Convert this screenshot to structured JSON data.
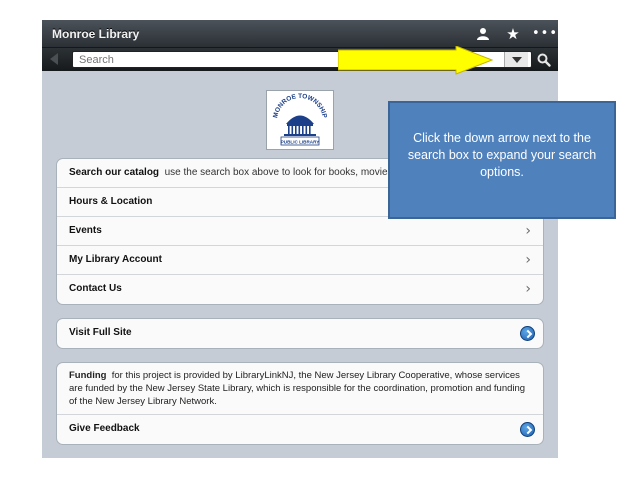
{
  "app": {
    "title": "Monroe Library",
    "toolbar_icons": [
      "person-icon",
      "star-icon",
      "more-icon"
    ]
  },
  "search": {
    "placeholder": "Search",
    "value": ""
  },
  "logo": {
    "text_top": "MONROE TOWNSHIP",
    "text_bottom": "PUBLIC LIBRARY"
  },
  "catalog": {
    "title": "Search our catalog",
    "description": "use the search box above to look for books, movies an"
  },
  "menu": [
    {
      "label": "Hours & Location"
    },
    {
      "label": "Events"
    },
    {
      "label": "My Library Account"
    },
    {
      "label": "Contact Us"
    }
  ],
  "full_site": {
    "label": "Visit Full Site"
  },
  "funding": {
    "title": "Funding",
    "text": "for this project is provided by LibraryLinkNJ, the New Jersey Library Cooperative, whose services are funded by the New Jersey State Library, which is responsible for the coordination, promotion and funding of the New Jersey Library Network."
  },
  "feedback": {
    "label": "Give Feedback"
  },
  "callout": {
    "text": "Click the down arrow next to the search box to expand your search options."
  },
  "colors": {
    "callout_bg": "#4f81bd",
    "arrow": "#ffff00",
    "screen_bg": "#c5ccd5"
  }
}
